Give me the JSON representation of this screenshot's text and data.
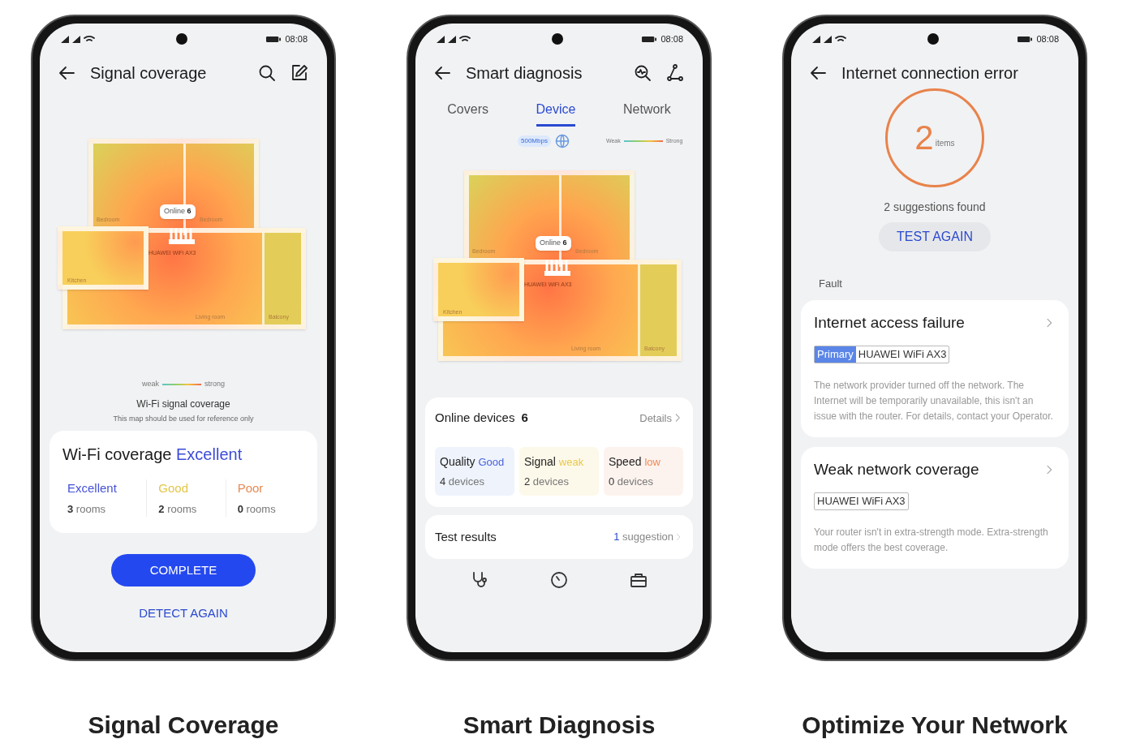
{
  "phones": [
    {
      "kind": "coverage",
      "status_time": "08:08",
      "title": "Signal coverage",
      "map": {
        "online_label": "Online",
        "online_count": "6",
        "router": "HUAWEI WiFi AX3",
        "rooms": [
          "Bedroom",
          "Bedroom",
          "Kitchen",
          "Living room",
          "Balcony"
        ]
      },
      "legend": {
        "weak": "weak",
        "strong": "strong"
      },
      "map_title": "Wi-Fi signal coverage",
      "map_note": "This map should be used for reference only",
      "summary": {
        "label": "Wi-Fi coverage",
        "value": "Excellent"
      },
      "levels": [
        {
          "name": "Excellent",
          "count": "3",
          "unit": "rooms",
          "color": "#4452d6"
        },
        {
          "name": "Good",
          "count": "2",
          "unit": "rooms",
          "color": "#e3c648"
        },
        {
          "name": "Poor",
          "count": "0",
          "unit": "rooms",
          "color": "#e58a52"
        }
      ],
      "primary_button": "COMPLETE",
      "secondary_button": "DETECT AGAIN",
      "caption": "Signal Coverage"
    },
    {
      "kind": "diagnosis",
      "status_time": "08:08",
      "title": "Smart diagnosis",
      "tabs": [
        {
          "label": "Covers",
          "selected": false
        },
        {
          "label": "Device",
          "selected": true
        },
        {
          "label": "Network",
          "selected": false
        }
      ],
      "speed": "500Mbps",
      "legend": {
        "weak": "Weak",
        "strong": "Strong"
      },
      "map": {
        "online_label": "Online",
        "online_count": "6",
        "router": "HUAWEI WiFi AX3",
        "rooms": [
          "Bedroom",
          "Bedroom",
          "Kitchen",
          "Living room",
          "Balcony"
        ]
      },
      "online": {
        "label": "Online devices",
        "count": "6",
        "link": "Details"
      },
      "stats": [
        {
          "label": "Quality",
          "value": "Good",
          "count": "4",
          "unit": "devices",
          "color": "#4a62d8"
        },
        {
          "label": "Signal",
          "value": "weak",
          "count": "2",
          "unit": "devices",
          "color": "#e8c84a"
        },
        {
          "label": "Speed",
          "value": "low",
          "count": "0",
          "unit": "devices",
          "color": "#ec8a5a"
        }
      ],
      "results": {
        "label": "Test results",
        "count": "1",
        "unit": "suggestion"
      },
      "caption": "Smart Diagnosis"
    },
    {
      "kind": "error",
      "status_time": "08:08",
      "title": "Internet connection error",
      "count": "2",
      "count_unit": "items",
      "found": "2 suggestions found",
      "button": "TEST AGAIN",
      "section": "Fault",
      "faults": [
        {
          "title": "Internet access failure",
          "primary_tag": "Primary",
          "device": "HUAWEI WiFi AX3",
          "description": "The network provider turned off the network. The Internet will be temporarily unavailable, this isn't an issue with the router. For details, contact your Operator."
        },
        {
          "title": "Weak network coverage",
          "device": "HUAWEI WiFi AX3",
          "description": "Your router isn't in extra-strength mode. Extra-strength mode offers the best coverage."
        }
      ],
      "caption": "Optimize Your Network"
    }
  ]
}
